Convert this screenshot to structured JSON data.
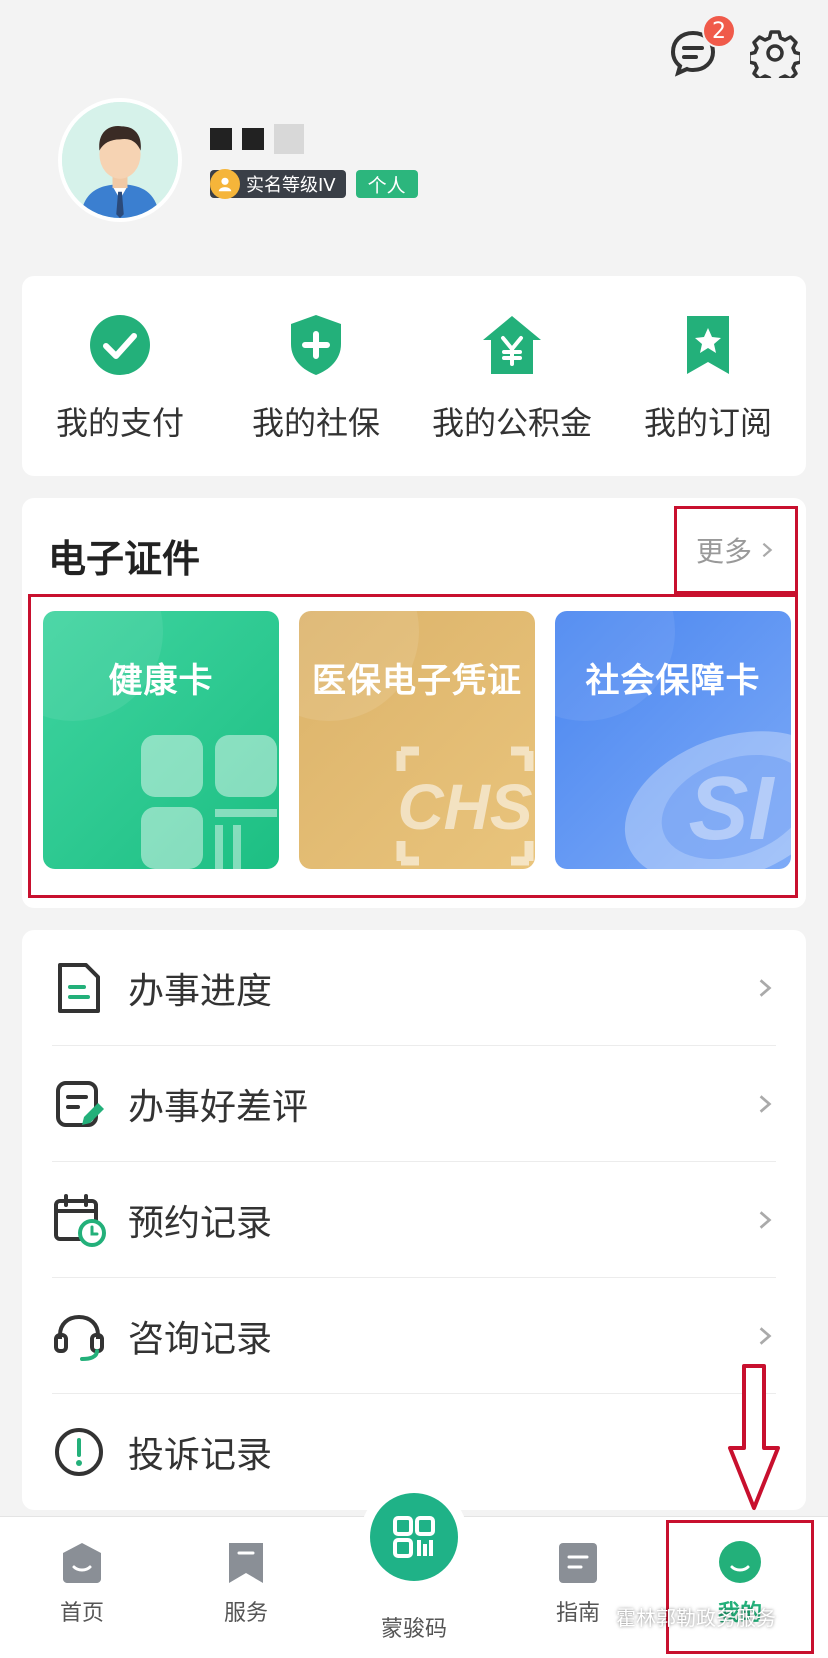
{
  "header": {
    "message_badge": "2"
  },
  "profile": {
    "name_masked": "■ ■ ▒",
    "level_tag": "实名等级IV",
    "type_tag": "个人"
  },
  "quick_actions": [
    {
      "label": "我的支付",
      "icon": "check-circle-icon"
    },
    {
      "label": "我的社保",
      "icon": "shield-plus-icon"
    },
    {
      "label": "我的公积金",
      "icon": "house-yen-icon"
    },
    {
      "label": "我的订阅",
      "icon": "bookmark-star-icon"
    }
  ],
  "certificates": {
    "title": "电子证件",
    "more_label": "更多",
    "cards": [
      {
        "label": "健康卡"
      },
      {
        "label": "医保电子凭证"
      },
      {
        "label": "社会保障卡"
      }
    ]
  },
  "list": [
    {
      "label": "办事进度",
      "icon": "folder-icon"
    },
    {
      "label": "办事好差评",
      "icon": "review-edit-icon"
    },
    {
      "label": "预约记录",
      "icon": "calendar-clock-icon"
    },
    {
      "label": "咨询记录",
      "icon": "headset-icon"
    },
    {
      "label": "投诉记录",
      "icon": "alert-circle-icon"
    }
  ],
  "tabbar": {
    "home": "首页",
    "service": "服务",
    "code": "蒙骏码",
    "guide": "指南",
    "mine": "我的"
  },
  "watermark": "霍林郭勒政务服务",
  "colors": {
    "accent": "#23b07a",
    "highlight_box": "#c8102e",
    "badge": "#f05a4a"
  }
}
